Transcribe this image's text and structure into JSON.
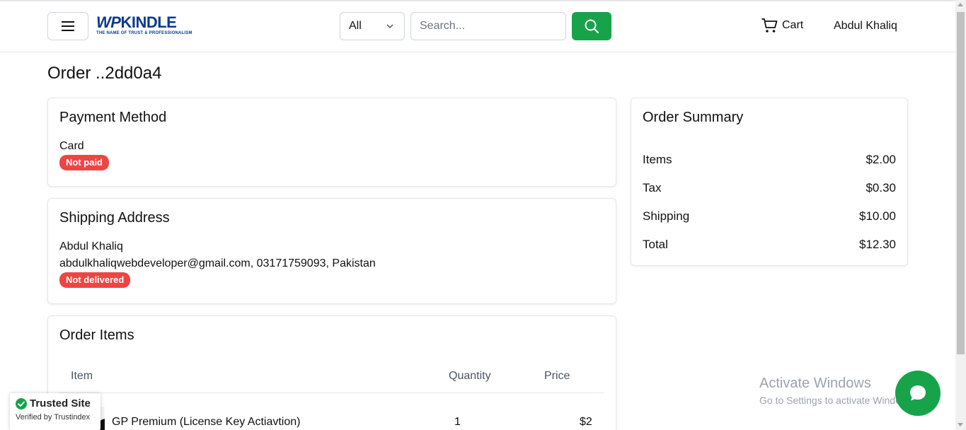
{
  "header": {
    "logo_main_wp": "WP",
    "logo_main_rest": "KINDLE",
    "logo_tagline": "THE NAME OF TRUST & PROFESSIONALISM",
    "category_selected": "All",
    "search_placeholder": "Search...",
    "cart_label": "Cart",
    "user_name": "Abdul Khaliq"
  },
  "page": {
    "title": "Order ..2dd0a4"
  },
  "payment": {
    "heading": "Payment Method",
    "method": "Card",
    "status": "Not paid"
  },
  "shipping": {
    "heading": "Shipping Address",
    "name": "Abdul Khaliq",
    "details": "abdulkhaliqwebdeveloper@gmail.com, 03171759093, Pakistan",
    "status": "Not delivered"
  },
  "order_items": {
    "heading": "Order Items",
    "columns": [
      "Item",
      "Quantity",
      "Price"
    ],
    "rows": [
      {
        "name": "GP Premium (License Key Actiavtion)",
        "quantity": "1",
        "price": "$2"
      }
    ]
  },
  "summary": {
    "heading": "Order Summary",
    "rows": [
      {
        "label": "Items",
        "value": "$2.00"
      },
      {
        "label": "Tax",
        "value": "$0.30"
      },
      {
        "label": "Shipping",
        "value": "$10.00"
      },
      {
        "label": "Total",
        "value": "$12.30"
      }
    ]
  },
  "trust_badge": {
    "title": "Trusted Site",
    "subtitle": "Verified by Trustindex"
  },
  "windows_watermark": {
    "line1": "Activate Windows",
    "line2": "Go to Settings to activate Windows."
  },
  "colors": {
    "accent_green": "#16a34a",
    "badge_red": "#ef4444",
    "logo_blue": "#0d3a8c"
  },
  "icons": [
    "hamburger-menu-icon",
    "chevron-down-icon",
    "search-icon",
    "cart-icon",
    "check-circle-icon",
    "chat-icon"
  ]
}
